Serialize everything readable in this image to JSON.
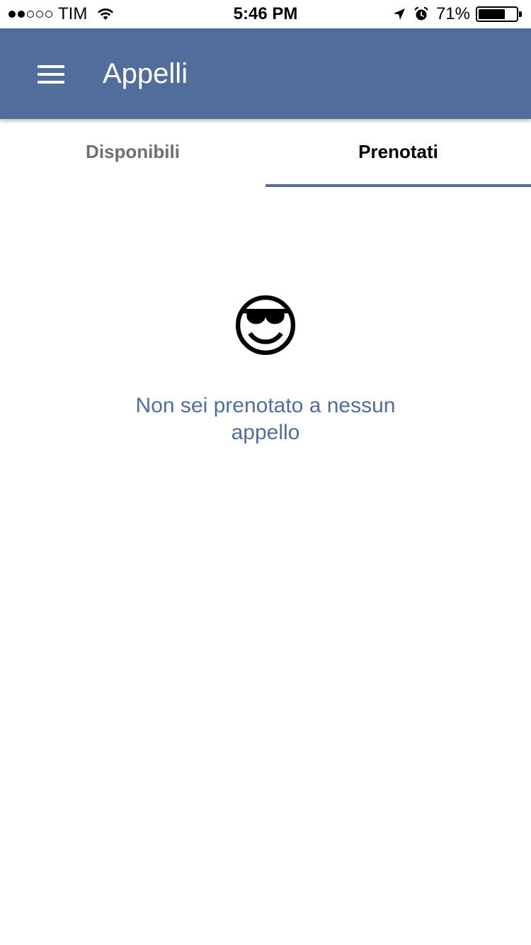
{
  "status_bar": {
    "carrier": "TIM",
    "signal_strength": "2 of 5",
    "time": "5:46 PM",
    "battery_percent": "71%",
    "battery_level": 0.71,
    "icons": [
      "wifi-icon",
      "location-arrow-icon",
      "alarm-clock-icon",
      "battery-icon"
    ]
  },
  "app_bar": {
    "title": "Appelli",
    "menu_icon": "hamburger-menu-icon",
    "color": "#516d9b"
  },
  "tabs": [
    {
      "label": "Disponibili",
      "active": false
    },
    {
      "label": "Prenotati",
      "active": true
    }
  ],
  "empty_state": {
    "emoji": "😎",
    "emoji_name": "smiling-face-with-sunglasses",
    "message": "Non sei prenotato a nessun appello"
  },
  "colors": {
    "accent": "#516d9b",
    "tab_active_text": "#000000",
    "tab_inactive_text": "#6f6f6f",
    "background": "#ffffff"
  }
}
